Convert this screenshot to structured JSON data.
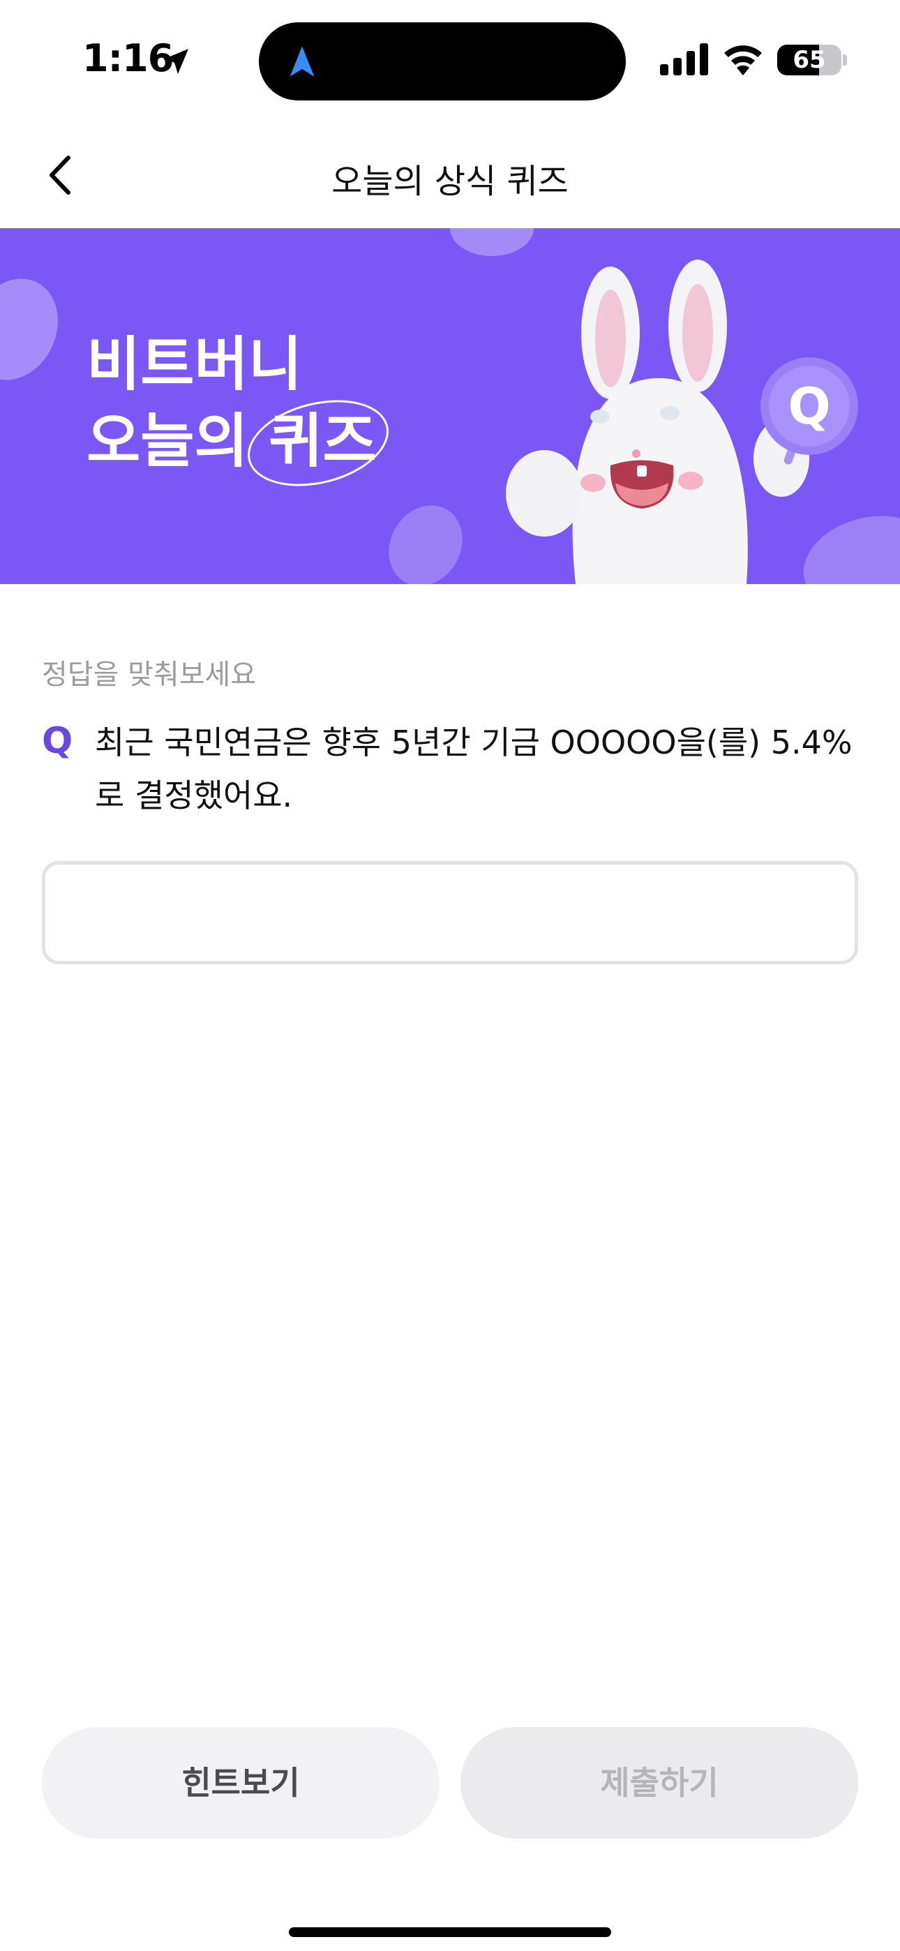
{
  "status_bar": {
    "time": "1:16",
    "battery_level": "65",
    "battery_fraction": 0.65,
    "icons": [
      "location-arrow-icon",
      "navigation-icon",
      "cellular-signal-icon",
      "wifi-icon",
      "battery-icon"
    ]
  },
  "header": {
    "title": "오늘의 상식 퀴즈",
    "back_icon": "chevron-left-icon"
  },
  "banner": {
    "line1": "비트버니",
    "line2_prefix": "오늘의 ",
    "line2_highlight": "퀴즈",
    "badge_letter": "Q",
    "background_color": "#7b58f5"
  },
  "quiz": {
    "instruction": "정답을 맞춰보세요",
    "q_label": "Q",
    "question": "최근 국민연금은 향후 5년간 기금 OOOOO을(를) 5.4%로 결정했어요.",
    "answer_value": "",
    "accent_color": "#6a48e0"
  },
  "actions": {
    "hint_label": "힌트보기",
    "submit_label": "제출하기"
  }
}
